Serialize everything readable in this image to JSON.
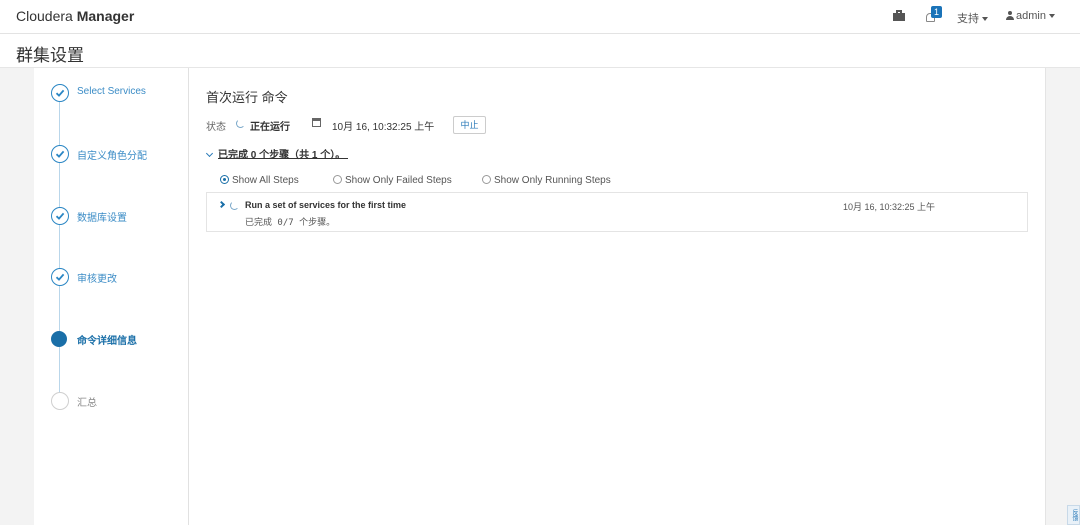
{
  "app": {
    "brand_light": "Cloudera ",
    "brand_bold": "Manager"
  },
  "navbar": {
    "parcel_icon": "parcel-icon",
    "notification_count": "1",
    "support_label": "支持",
    "user_label": "admin"
  },
  "page": {
    "title": "群集设置"
  },
  "wizard_steps": [
    {
      "label": "Select Services",
      "state": "done"
    },
    {
      "label": "自定义角色分配",
      "state": "done"
    },
    {
      "label": "数据库设置",
      "state": "done"
    },
    {
      "label": "审核更改",
      "state": "done"
    },
    {
      "label": "命令详细信息",
      "state": "active"
    },
    {
      "label": "汇总",
      "state": "pending"
    }
  ],
  "command": {
    "title": "首次运行 命令",
    "status_label": "状态",
    "status_value": "正在运行",
    "start_time": "10月 16, 10:32:25 上午",
    "abort_label": "中止",
    "summary": "已完成 0 个步骤（共 1 个）。"
  },
  "filters": {
    "all": "Show All Steps",
    "failed": "Show Only Failed Steps",
    "running": "Show Only Running Steps",
    "selected": "all"
  },
  "steps_list": [
    {
      "name": "Run a set of services for the first time",
      "progress": "已完成 0/7 个步骤。",
      "time": "10月 16, 10:32:25 上午"
    }
  ],
  "feedback_tab": "反馈",
  "colors": {
    "accent": "#1a6fa8",
    "link": "#3b8cc6",
    "background": "#f3f3f3"
  }
}
